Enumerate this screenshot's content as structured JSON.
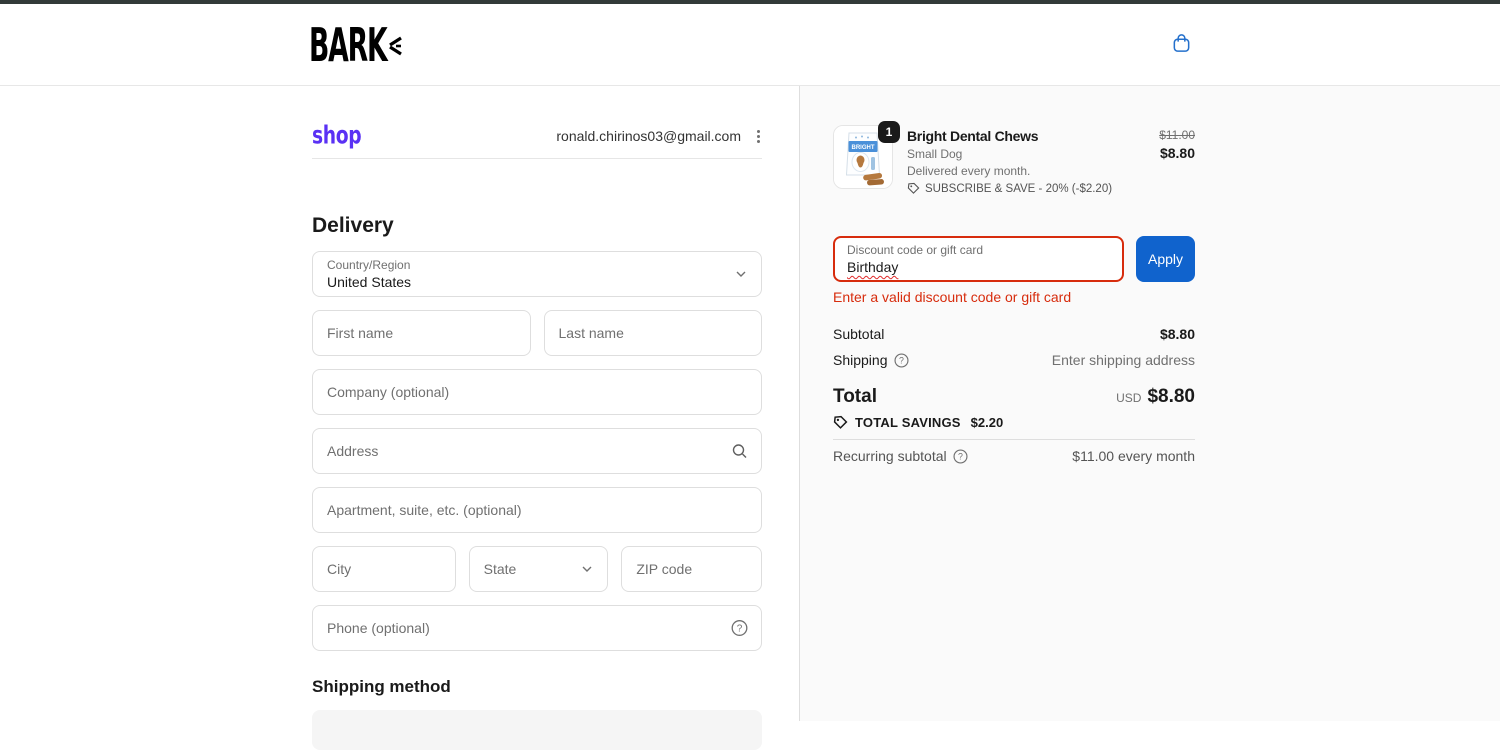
{
  "header": {
    "brand": "BARK"
  },
  "wallet": {
    "logo_text": "shop",
    "email": "ronald.chirinos03@gmail.com"
  },
  "delivery": {
    "title": "Delivery",
    "country_label": "Country/Region",
    "country_value": "United States",
    "first_name_placeholder": "First name",
    "last_name_placeholder": "Last name",
    "company_placeholder": "Company (optional)",
    "address_placeholder": "Address",
    "apartment_placeholder": "Apartment, suite, etc. (optional)",
    "city_placeholder": "City",
    "state_placeholder": "State",
    "zip_placeholder": "ZIP code",
    "phone_placeholder": "Phone (optional)"
  },
  "shipping_method": {
    "title": "Shipping method"
  },
  "order_summary": {
    "item": {
      "quantity": "1",
      "title": "Bright Dental Chews",
      "variant": "Small Dog",
      "frequency": "Delivered every month.",
      "promo": "SUBSCRIBE & SAVE - 20% (-$2.20)",
      "original_price": "$11.00",
      "price": "$8.80"
    },
    "discount": {
      "label": "Discount code or gift card",
      "value": "Birthday",
      "apply_label": "Apply",
      "error": "Enter a valid discount code or gift card"
    },
    "totals": {
      "subtotal_label": "Subtotal",
      "subtotal_value": "$8.80",
      "shipping_label": "Shipping",
      "shipping_value": "Enter shipping address",
      "total_label": "Total",
      "currency": "USD",
      "total_value": "$8.80",
      "savings_label": "TOTAL SAVINGS",
      "savings_value": "$2.20",
      "recurring_label": "Recurring subtotal",
      "recurring_value": "$11.00 every month"
    }
  },
  "colors": {
    "accent_blue": "#1063cd",
    "error_red": "#d72c0d",
    "shop_purple": "#5a31f4",
    "panel_bg": "#fafafa",
    "top_strip": "#323a39"
  }
}
